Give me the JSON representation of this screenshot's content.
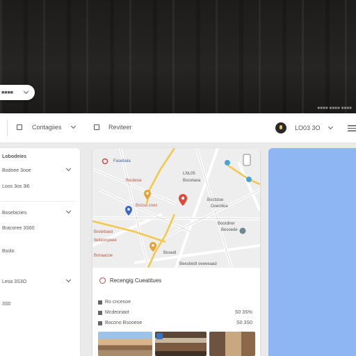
{
  "backdrop": {
    "caption": "■■■■ ■■■■ ■■■■"
  },
  "top_pill": {
    "label": "■■■■"
  },
  "toolbar": {
    "categories_label": "Contagiies",
    "reviews_label": "Reviteer",
    "location_label": "LO03 3O"
  },
  "sidebar": {
    "items": [
      {
        "label": "Lobodeies"
      },
      {
        "label": "Bodnee 3ooe"
      },
      {
        "label": "Loos 3os 3i6"
      },
      {
        "label": "Bosebiciies"
      },
      {
        "label": "Bracoree 3S60"
      },
      {
        "label": "Bsolo"
      },
      {
        "label": "Lesa 3S3O"
      },
      {
        "label": "3S0"
      }
    ]
  },
  "map": {
    "labels": [
      {
        "text": "Fasebuia",
        "color": "#3b62b0"
      },
      {
        "text": "Beuteoa",
        "color": "#c2573e"
      },
      {
        "text": "LNL05",
        "color": "#555555"
      },
      {
        "text": "Bocetaoa",
        "color": "#555555"
      },
      {
        "text": "Boctstoe",
        "color": "#555555"
      },
      {
        "text": "Ooerdioa",
        "color": "#555555"
      },
      {
        "text": "Boordirer",
        "color": "#555555"
      },
      {
        "text": "Besoede",
        "color": "#555555"
      },
      {
        "text": "Bozoa cnos",
        "color": "#c2573e"
      },
      {
        "text": "Bretetiaed",
        "color": "#c2573e"
      },
      {
        "text": "Ileiteonpeee",
        "color": "#c2573e"
      },
      {
        "text": "Bonaacoe",
        "color": "#c2573e"
      },
      {
        "text": "Beeutiedt oeeeeaad",
        "color": "#555555"
      },
      {
        "text": "Bosedi",
        "color": "#555555"
      }
    ]
  },
  "recommendations": {
    "title": "Recengig Cueatitues",
    "rows": [
      {
        "label": "Ro cncesoe",
        "value": ""
      },
      {
        "label": "Mcdeoriaot",
        "value": "S0 3S%"
      },
      {
        "label": "Bocono Bsooeoe",
        "value": "S0 3S0"
      }
    ]
  },
  "colors": {
    "route": "#f2c94c",
    "pin_red": "#e0483b",
    "pin_orange": "#e8a230",
    "pin_blue": "#3d67c4",
    "panel_blue": "#8eb6f3"
  }
}
